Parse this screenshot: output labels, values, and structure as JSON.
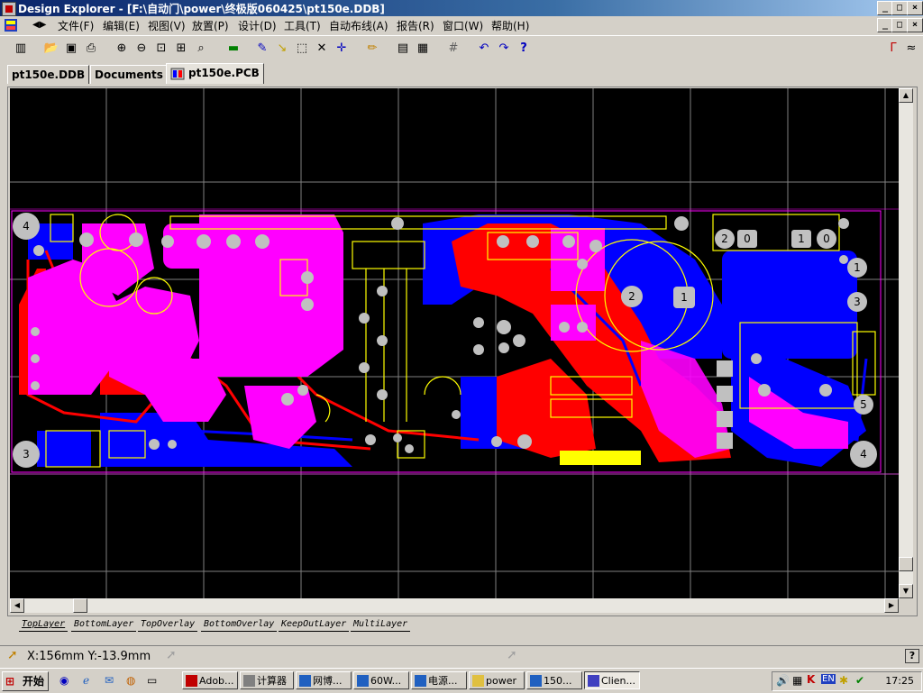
{
  "window": {
    "title": "Design Explorer - [F:\\自动门\\power\\终极版060425\\pt150e.DDB]"
  },
  "menu": {
    "items": [
      "文件(F)",
      "编辑(E)",
      "视图(V)",
      "放置(P)",
      "设计(D)",
      "工具(T)",
      "自动布线(A)",
      "报告(R)",
      "窗口(W)",
      "帮助(H)"
    ]
  },
  "tabs": {
    "items": [
      "pt150e.DDB",
      "Documents",
      "pt150e.PCB"
    ],
    "active": "pt150e.PCB"
  },
  "pcb": {
    "pad_labels": {
      "left_top": "4",
      "left_bottom": "3",
      "mid_2": "2",
      "mid_1": "1",
      "conn_2": "2",
      "conn_0a": "0",
      "conn_1": "1",
      "conn_0b": "0",
      "right_1": "1",
      "right_3": "3",
      "right_5": "5",
      "right_4": "4"
    },
    "colors": {
      "top_layer": "#ff0000",
      "bottom_layer": "#0000ff",
      "multi_layer": "#ff00ff",
      "overlay": "#ffff00",
      "pad": "#c0c0c0",
      "grid": "#808080"
    }
  },
  "layers": [
    "TopLayer",
    "BottomLayer",
    "TopOverlay",
    "BottomOverlay",
    "KeepOutLayer",
    "MultiLayer"
  ],
  "status": {
    "coords": "X:156mm Y:-13.9mm"
  },
  "taskbar": {
    "start": "开始",
    "tasks": [
      "Adob...",
      "计算器",
      "网博...",
      "60W...",
      "电源...",
      "power",
      "150...",
      "Clien..."
    ],
    "active_task": "Clien...",
    "tray_lang": "EN",
    "clock": "17:25"
  }
}
